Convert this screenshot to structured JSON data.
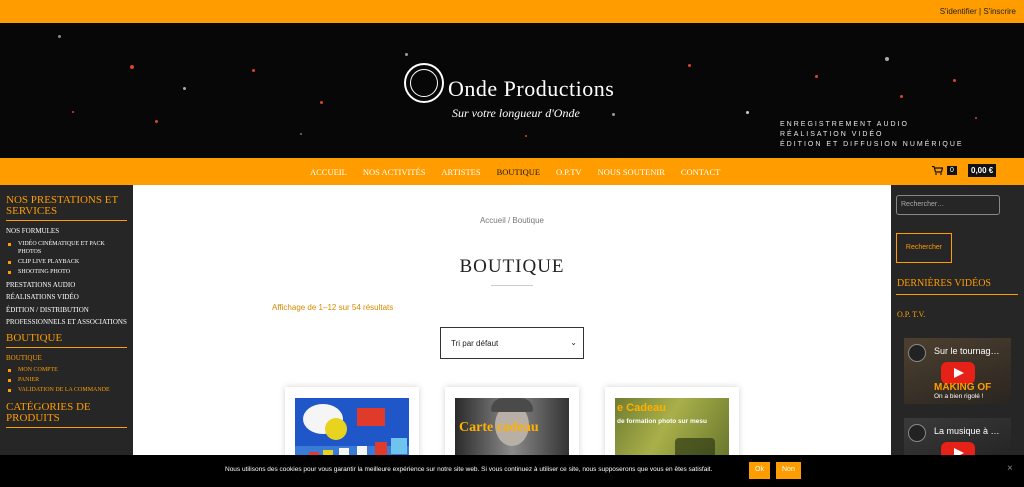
{
  "topbar": {
    "login": "S'identifier",
    "divider": "|",
    "register": "S'inscrire"
  },
  "brand": {
    "name": "Onde Productions",
    "tagline": "Sur votre longueur d'Onde"
  },
  "services": [
    "Enregistrement audio",
    "Réalisation vidéo",
    "Édition et diffusion numérique"
  ],
  "nav": {
    "items": [
      "ACCUEIL",
      "NOS ACTIVITÉS",
      "ARTISTES",
      "BOUTIQUE",
      "O.P.TV",
      "NOUS SOUTENIR",
      "CONTACT"
    ],
    "active": "BOUTIQUE"
  },
  "cart": {
    "icon": "cart-icon",
    "count": "0",
    "total": "0,00 €"
  },
  "sidebar_left": {
    "heading1": "NOS PRESTATIONS ET SERVICES",
    "formules": "Nos formules",
    "formules_items": [
      "Vidéo cinématique et pack photos",
      "Clip live playback",
      "Shooting photo"
    ],
    "links": [
      "Prestations audio",
      "Réalisations vidéo",
      "Édition / Distribution",
      "Professionnels et associations"
    ],
    "heading2": "BOUTIQUE",
    "boutique": "Boutique",
    "boutique_items": [
      "Mon compte",
      "Panier",
      "Validation de la commande"
    ],
    "heading3": "CATÉGORIES DE PRODUITS"
  },
  "main": {
    "breadcrumb": "Accueil / Boutique",
    "title": "BOUTIQUE",
    "result_count": "Affichage de 1–12 sur 54 résultats",
    "sort": {
      "value": "Tri par défaut"
    },
    "products": [
      {
        "label": "album cover collage",
        "colors": [
          "#1f56c8",
          "#e8d31e",
          "#e03a2a",
          "#f5f5f5"
        ]
      },
      {
        "label": "Carte cadeau portrait",
        "text": "Carte cadeau"
      },
      {
        "label": "Carte cadeau formation photo",
        "text": "e Cadeau",
        "subtext": "de formation photo sur mesu"
      }
    ]
  },
  "sidebar_right": {
    "search_placeholder": "Rechercher…",
    "search_button": "Rechercher",
    "videos_title": "DERNIÈRES VIDÉOS",
    "channel": "O.P. T.V.",
    "videos": [
      {
        "title": "Sur le tournag…",
        "overlay1": "MAKING OF",
        "overlay2": "On a bien rigolé !"
      },
      {
        "title": "La musique à …",
        "overlay1": "",
        "overlay2": ""
      }
    ]
  },
  "cookie": {
    "message": "Nous utilisons des cookies pour vous garantir la meilleure expérience sur notre site web. Si vous continuez à utiliser ce site, nous supposerons que vous en êtes satisfait.",
    "ok": "Ok",
    "no": "Non",
    "close": "×"
  },
  "colors": {
    "accent": "#ff9c00",
    "dark": "#262626",
    "hero": "#070707"
  }
}
